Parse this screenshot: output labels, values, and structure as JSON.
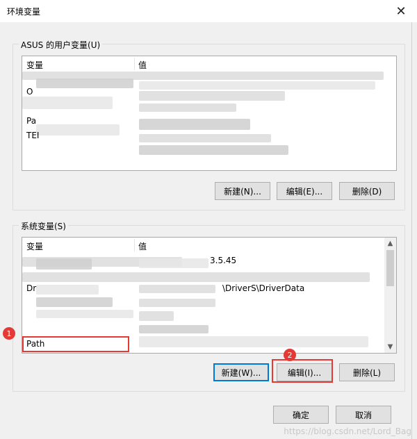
{
  "window": {
    "title": "环境变量",
    "close_glyph": "✕"
  },
  "user_vars": {
    "legend": "ASUS 的用户变量(U)",
    "col_variable": "变量",
    "col_value": "值",
    "rows": [
      {
        "name_fragment": "O"
      },
      {
        "name_fragment": "Pa"
      },
      {
        "name_fragment": "TEI"
      }
    ],
    "buttons": {
      "new": "新建(N)...",
      "edit": "编辑(E)...",
      "delete": "删除(D)"
    }
  },
  "system_vars": {
    "legend": "系统变量(S)",
    "col_variable": "变量",
    "col_value": "值",
    "rows": [
      {
        "name_fragment": "",
        "value_fragment": "3.5.45"
      },
      {
        "name_fragment": "Dr",
        "value_fragment": "\\DriverS\\DriverData"
      },
      {
        "name": "Path"
      }
    ],
    "buttons": {
      "new": "新建(W)...",
      "edit": "编辑(I)...",
      "delete": "删除(L)"
    }
  },
  "footer": {
    "ok": "确定",
    "cancel": "取消"
  },
  "annotations": {
    "badge1": "1",
    "badge2": "2"
  },
  "watermark": "https://blog.csdn.net/Lord_Bag",
  "colors": {
    "accent": "#0078d7",
    "annotation": "#e53935"
  }
}
